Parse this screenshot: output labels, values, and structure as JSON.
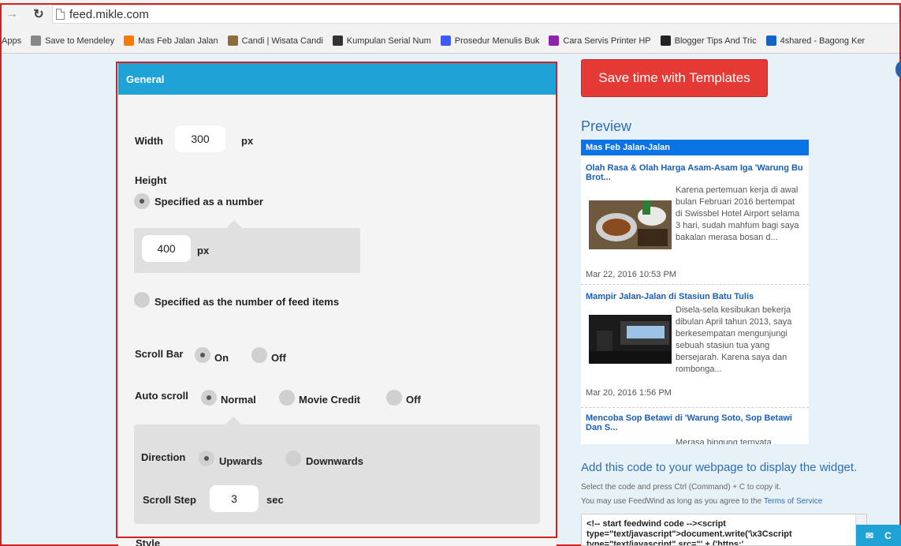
{
  "browser": {
    "back_icon": "arrow-right-icon",
    "reload_icon": "reload-icon",
    "url": "feed.mikle.com"
  },
  "bookmarks": [
    {
      "label": "Apps",
      "icon": "apps-icon",
      "color": "#4a90d9"
    },
    {
      "label": "Save to Mendeley",
      "icon": "page-icon",
      "color": "#888888"
    },
    {
      "label": "Mas Feb Jalan Jalan",
      "icon": "blogger-icon",
      "color": "#f57c00"
    },
    {
      "label": "Candi | Wisata Candi",
      "icon": "temple-icon",
      "color": "#8d6e3b"
    },
    {
      "label": "Kumpulan Serial Num",
      "icon": "serial-icon",
      "color": "#333333"
    },
    {
      "label": "Prosedur Menulis Buk",
      "icon": "y-icon",
      "color": "#3d5afe"
    },
    {
      "label": "Cara Servis Printer HP",
      "icon": "e-icon",
      "color": "#8e24aa"
    },
    {
      "label": "Blogger Tips And Tric",
      "icon": "bt-icon",
      "color": "#222222"
    },
    {
      "label": "4shared - Bagong Ker",
      "icon": "4shared-icon",
      "color": "#1565c0"
    }
  ],
  "settings": {
    "header": "General",
    "width_label": "Width",
    "width_value": "300",
    "width_unit": "px",
    "height_label": "Height",
    "height_opt_number": "Specified as a number",
    "height_value": "400",
    "height_unit": "px",
    "height_opt_items": "Specified as the number of feed items",
    "scrollbar_label": "Scroll Bar",
    "scrollbar_on": "On",
    "scrollbar_off": "Off",
    "autoscroll_label": "Auto scroll",
    "autoscroll_normal": "Normal",
    "autoscroll_movie": "Movie Credit",
    "autoscroll_off": "Off",
    "direction_label": "Direction",
    "direction_up": "Upwards",
    "direction_down": "Downwards",
    "step_label": "Scroll Step",
    "step_value": "3",
    "step_unit": "sec",
    "style_label": "Style"
  },
  "right": {
    "save_templates": "Save time with Templates",
    "preview_title": "Preview",
    "code_title": "Add this code to your webpage to display the widget.",
    "code_note_1": "Select the code and press Ctrl (Command) + C to copy it.",
    "code_note_2": "You may use FeedWind as long as you agree to the",
    "tos_link": "Terms of Service",
    "code_line_1": "<!-- start feedwind code --><script",
    "code_line_2": "type=\"text/javascript\">document.write('\\x3Cscript",
    "code_line_3": "type=\"text/javascript\" src=\"' + ('https:'",
    "chat_label": "C"
  },
  "widget": {
    "feed_title": "Mas Feb Jalan-Jalan",
    "items": [
      {
        "title": "Olah Rasa & Olah Harga Asam-Asam Iga 'Warung Bu Brot...",
        "desc": "Karena pertemuan kerja di awal bulan Februari 2016 bertempat di Swissbel Hotel Airport selama 3 hari, sudah mahfum bagi saya bakalan merasa bosan d...",
        "date": "Mar 22, 2016 10:53 PM"
      },
      {
        "title": "Mampir Jalan-Jalan di Stasiun Batu Tulis",
        "desc": "Disela-sela kesibukan bekerja dibulan April tahun 2013, saya berkesempatan mengunjungi sebuah stasiun tua yang bersejarah. Karena saya dan rombonga...",
        "date": "Mar 20, 2016 1:56 PM"
      },
      {
        "title": "Mencoba Sop Betawi di 'Warung Soto, Sop Betawi Dan S...",
        "desc": "Merasa bingung ternyata",
        "date": ""
      }
    ]
  }
}
